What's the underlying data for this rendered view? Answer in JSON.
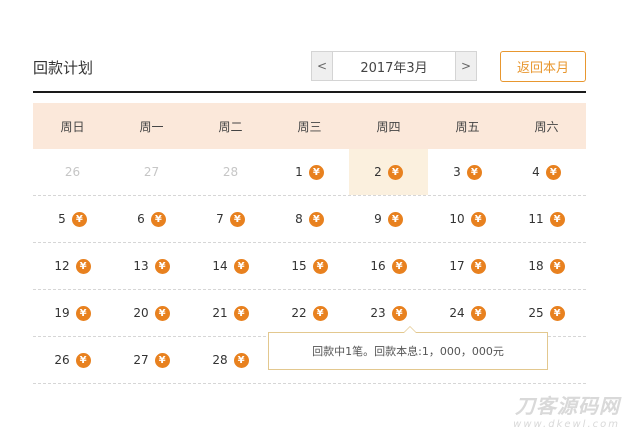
{
  "header": {
    "title": "回款计划",
    "prev_label": "<",
    "next_label": ">",
    "current_month": "2017年3月",
    "return_label": "返回本月"
  },
  "weekdays": [
    "周日",
    "周一",
    "周二",
    "周三",
    "周四",
    "周五",
    "周六"
  ],
  "coin_symbol": "¥",
  "weeks": [
    [
      {
        "d": "26",
        "other": true
      },
      {
        "d": "27",
        "other": true
      },
      {
        "d": "28",
        "other": true
      },
      {
        "d": "1",
        "coin": true
      },
      {
        "d": "2",
        "coin": true,
        "hl": true
      },
      {
        "d": "3",
        "coin": true
      },
      {
        "d": "4",
        "coin": true
      }
    ],
    [
      {
        "d": "5",
        "coin": true
      },
      {
        "d": "6",
        "coin": true
      },
      {
        "d": "7",
        "coin": true
      },
      {
        "d": "8",
        "coin": true
      },
      {
        "d": "9",
        "coin": true
      },
      {
        "d": "10",
        "coin": true
      },
      {
        "d": "11",
        "coin": true
      }
    ],
    [
      {
        "d": "12",
        "coin": true
      },
      {
        "d": "13",
        "coin": true
      },
      {
        "d": "14",
        "coin": true
      },
      {
        "d": "15",
        "coin": true
      },
      {
        "d": "16",
        "coin": true
      },
      {
        "d": "17",
        "coin": true
      },
      {
        "d": "18",
        "coin": true
      }
    ],
    [
      {
        "d": "19",
        "coin": true
      },
      {
        "d": "20",
        "coin": true
      },
      {
        "d": "21",
        "coin": true
      },
      {
        "d": "22",
        "coin": true
      },
      {
        "d": "23",
        "coin": true
      },
      {
        "d": "24",
        "coin": true
      },
      {
        "d": "25",
        "coin": true
      }
    ],
    [
      {
        "d": "26",
        "coin": true
      },
      {
        "d": "27",
        "coin": true
      },
      {
        "d": "28",
        "coin": true
      },
      {
        "d": "",
        "coin": false
      },
      {
        "d": "",
        "coin": false
      },
      {
        "d": "",
        "coin": false
      },
      {
        "d": "",
        "coin": false
      }
    ]
  ],
  "tooltip": {
    "text": "回款中1笔。回款本息:1，000，000元"
  },
  "watermark": {
    "main": "刀客源码网",
    "url": "www.dkewl.com"
  }
}
